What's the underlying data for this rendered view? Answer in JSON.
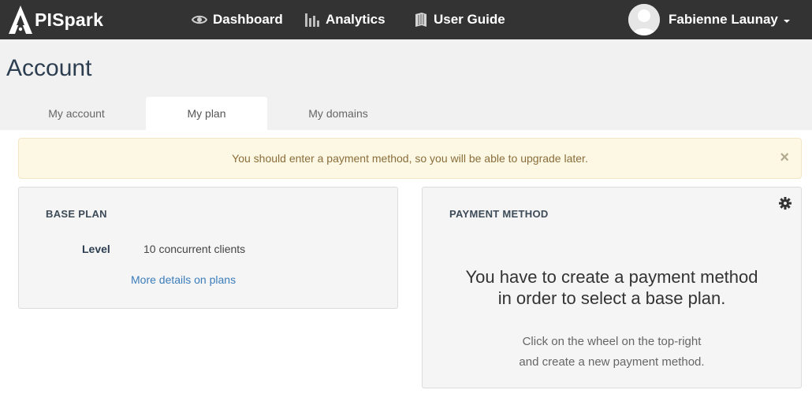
{
  "brand": {
    "logo_text": "PISpark",
    "logo_icon": "apispark-a-logo-icon"
  },
  "nav": {
    "items": [
      {
        "label": "Dashboard",
        "icon": "eye-icon"
      },
      {
        "label": "Analytics",
        "icon": "bar-chart-icon"
      },
      {
        "label": "User Guide",
        "icon": "book-icon"
      }
    ],
    "user": {
      "name": "Fabienne Launay",
      "icon": "avatar"
    }
  },
  "page": {
    "title": "Account"
  },
  "tabs": [
    {
      "label": "My account",
      "active": false
    },
    {
      "label": "My plan",
      "active": true
    },
    {
      "label": "My domains",
      "active": false
    }
  ],
  "alert": {
    "message": "You should enter a payment method, so you will be able to upgrade later.",
    "close_symbol": "×"
  },
  "base_plan": {
    "title": "BASE PLAN",
    "level_label": "Level",
    "level_value": "10 concurrent clients",
    "details_link": "More details on plans"
  },
  "payment_method": {
    "title": "PAYMENT METHOD",
    "message_line1": "You have to create a payment method",
    "message_line2": "in order to select a base plan.",
    "hint_line1": "Click on the wheel on the top-right",
    "hint_line2": "and create a new payment method.",
    "settings_icon": "gear-icon"
  },
  "colors": {
    "navbar": "#333333",
    "header_band": "#f1f1f1",
    "alert_bg": "#fcf8e3",
    "alert_text": "#8a6d3b",
    "link": "#3a7cbb",
    "title": "#2c3e50"
  }
}
